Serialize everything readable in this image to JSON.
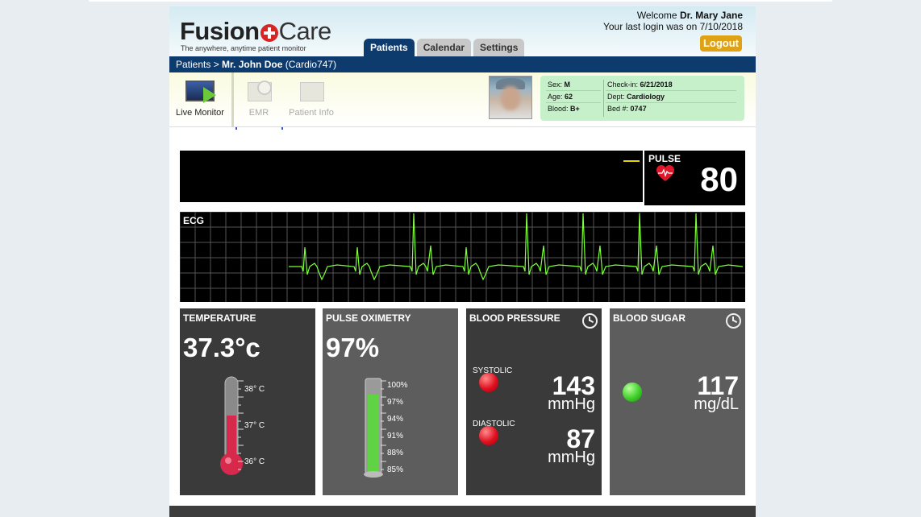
{
  "header": {
    "logo_part1": "Fusion",
    "logo_part2": "Care",
    "tagline": "The anywhere, anytime patient monitor",
    "welcome_prefix": "Welcome ",
    "user_name": "Dr. Mary Jane",
    "last_login": "Your last login was on 7/10/2018",
    "logout_label": "Logout"
  },
  "tabs": [
    {
      "label": "Patients",
      "active": true
    },
    {
      "label": "Calendar",
      "active": false
    },
    {
      "label": "Settings",
      "active": false
    }
  ],
  "breadcrumb": {
    "root": "Patients",
    "separator": " > ",
    "patient_name": "Mr. John Doe",
    "patient_id": "(Cardio747)"
  },
  "toolbar": {
    "live_monitor": "Live Monitor",
    "emr": "EMR",
    "patient_info": "Patient Info"
  },
  "patient": {
    "sex_label": "Sex:",
    "sex": "M",
    "age_label": "Age:",
    "age": "62",
    "blood_label": "Blood:",
    "blood": "B+",
    "checkin_label": "Check-in:",
    "checkin": "6/21/2018",
    "dept_label": "Dept:",
    "dept": "Cardiology",
    "bed_label": "Bed #:",
    "bed": "0747"
  },
  "pulse": {
    "label": "PULSE",
    "value": "80"
  },
  "ecg": {
    "label": "ECG"
  },
  "temperature": {
    "title": "TEMPERATURE",
    "value": "37.3°c",
    "scale": [
      "38° C",
      "37° C",
      "36° C"
    ]
  },
  "oximetry": {
    "title": "PULSE OXIMETRY",
    "value": "97%",
    "scale": [
      "100%",
      "97%",
      "94%",
      "91%",
      "88%",
      "85%"
    ]
  },
  "blood_pressure": {
    "title": "BLOOD PRESSURE",
    "systolic_label": "SYSTOLIC",
    "systolic": "143",
    "diastolic_label": "DIASTOLIC",
    "diastolic": "87",
    "unit": "mmHg"
  },
  "blood_sugar": {
    "title": "BLOOD SUGAR",
    "value": "117",
    "unit": "mg/dL"
  },
  "colors": {
    "navy": "#0e3b6e",
    "logout": "#e0a215",
    "ecg_trace": "#7dff3a",
    "card_green": "#c6f0c9"
  }
}
